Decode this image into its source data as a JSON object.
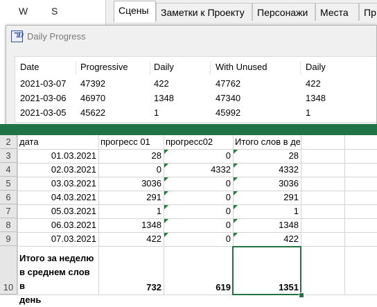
{
  "background_app": {
    "left_columns": [
      "W",
      "S"
    ],
    "tabs": [
      {
        "label": "Сцены",
        "active": true
      },
      {
        "label": "Заметки к Проекту",
        "active": false
      },
      {
        "label": "Персонажи",
        "active": false
      },
      {
        "label": "Места",
        "active": false
      },
      {
        "label": "Пр",
        "active": false
      }
    ]
  },
  "dialog": {
    "title": "Daily Progress",
    "columns": [
      "Date",
      "Progressive",
      "Daily",
      "With Unused",
      "Daily"
    ],
    "rows": [
      [
        "2021-03-07",
        "47392",
        "422",
        "47762",
        "422"
      ],
      [
        "2021-03-06",
        "46970",
        "1348",
        "47340",
        "1348"
      ],
      [
        "2021-03-05",
        "45622",
        "1",
        "45992",
        "1"
      ]
    ]
  },
  "spreadsheet": {
    "accent_color": "#217346",
    "header_row": {
      "row": "2",
      "cells": [
        "дата",
        "прогресс 01",
        "прогресс02",
        "Итого слов в день"
      ]
    },
    "rows": [
      {
        "row": "3",
        "cells": [
          "01.03.2021",
          "28",
          "0",
          "28"
        ]
      },
      {
        "row": "4",
        "cells": [
          "02.03.2021",
          "0",
          "4332",
          "4332"
        ]
      },
      {
        "row": "5",
        "cells": [
          "03.03.2021",
          "3036",
          "0",
          "3036"
        ]
      },
      {
        "row": "6",
        "cells": [
          "04.03.2021",
          "291",
          "0",
          "291"
        ]
      },
      {
        "row": "7",
        "cells": [
          "05.03.2021",
          "1",
          "0",
          "1"
        ]
      },
      {
        "row": "8",
        "cells": [
          "06.03.2021",
          "1348",
          "0",
          "1348"
        ]
      },
      {
        "row": "9",
        "cells": [
          "07.03.2021",
          "422",
          "0",
          "422"
        ]
      }
    ],
    "total_row": {
      "row": "10",
      "label_lines": [
        "Итого за неделю",
        "в среднем слов в",
        "день"
      ],
      "values": [
        "732",
        "619",
        "1351"
      ]
    }
  }
}
